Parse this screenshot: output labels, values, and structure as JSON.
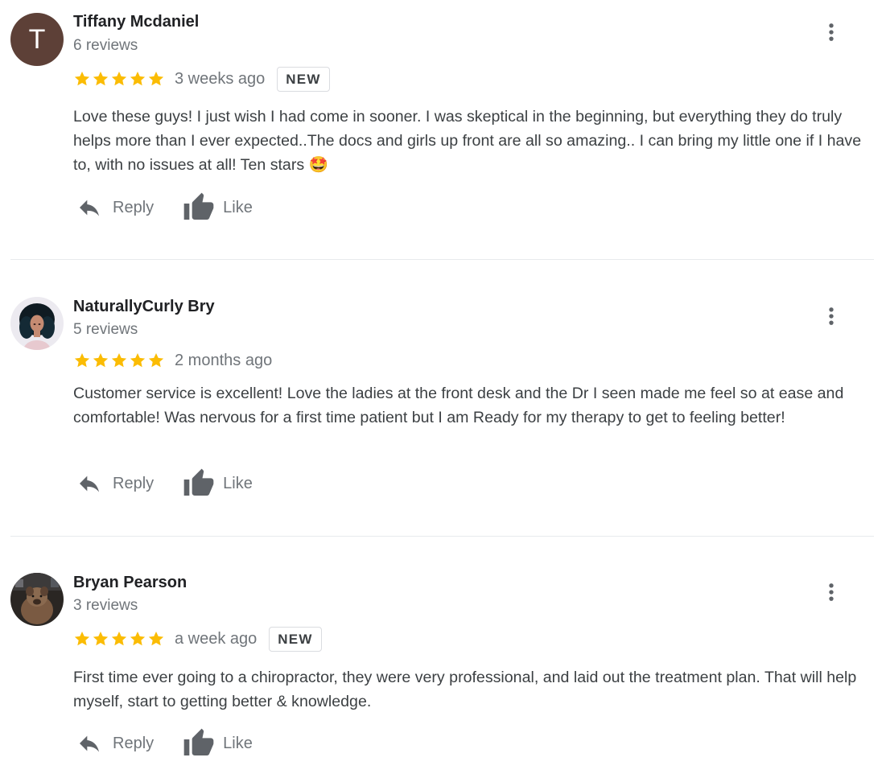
{
  "colors": {
    "star": "#fbbc04",
    "name": "#202124",
    "secondary": "#70757a",
    "body_text": "#3c4043",
    "divider": "#e8eaed",
    "avatar_letter_bg": "#5d4037"
  },
  "icons": {
    "star": "star-icon",
    "reply": "reply-icon",
    "like": "thumbs-up-icon",
    "menu": "more-vert-icon"
  },
  "reviews": [
    {
      "avatar_letter": "T",
      "name": "Tiffany Mcdaniel",
      "review_count": "6 reviews",
      "rating": 5,
      "date": "3 weeks ago",
      "badge": "NEW",
      "text": "Love these guys! I just wish I had come in sooner. I was skeptical in the beginning, but everything they do truly helps more than I ever expected..The docs and girls up front are all so amazing.. I can bring my little one  if I have to, with no issues at all! Ten stars 🤩",
      "reply_label": "Reply",
      "like_label": "Like"
    },
    {
      "name": "NaturallyCurly Bry",
      "review_count": "5 reviews",
      "rating": 5,
      "date": "2 months ago",
      "text": "Customer service is excellent! Love the ladies at the front desk and the Dr I seen made me feel so at ease and comfortable! Was nervous for a first time patient but I am Ready for my therapy to get to feeling better!",
      "reply_label": "Reply",
      "like_label": "Like"
    },
    {
      "name": "Bryan Pearson",
      "review_count": "3 reviews",
      "rating": 5,
      "date": "a week ago",
      "badge": "NEW",
      "text": "First time ever going to a chiropractor, they were very professional, and laid out the treatment plan. That will help myself, start to getting better & knowledge.",
      "reply_label": "Reply",
      "like_label": "Like"
    }
  ]
}
